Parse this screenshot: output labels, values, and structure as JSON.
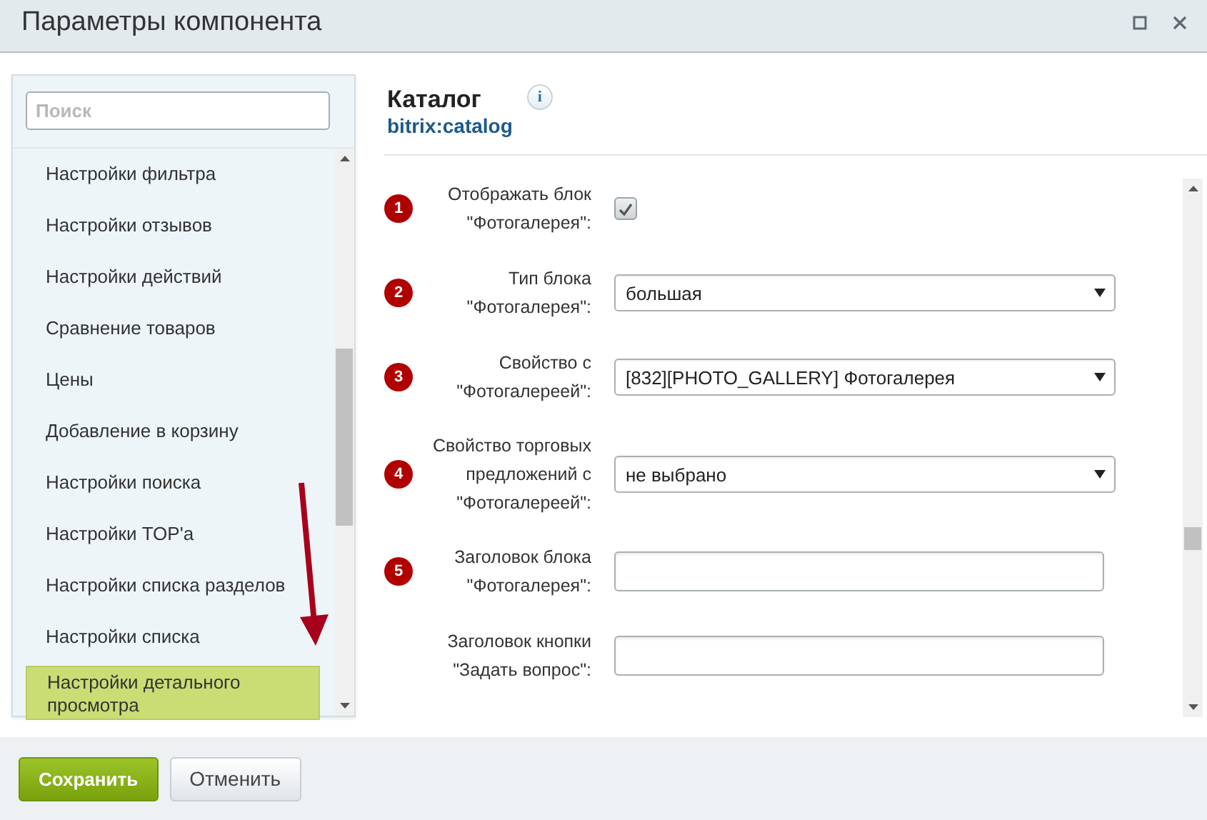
{
  "window": {
    "title": "Параметры компонента"
  },
  "sidebar": {
    "search": {
      "placeholder": "Поиск"
    },
    "items": [
      {
        "label": "Настройки фильтра",
        "selected": false
      },
      {
        "label": "Настройки отзывов",
        "selected": false
      },
      {
        "label": "Настройки действий",
        "selected": false
      },
      {
        "label": "Сравнение товаров",
        "selected": false
      },
      {
        "label": "Цены",
        "selected": false
      },
      {
        "label": "Добавление в корзину",
        "selected": false
      },
      {
        "label": "Настройки поиска",
        "selected": false
      },
      {
        "label": "Настройки TOP'a",
        "selected": false
      },
      {
        "label": "Настройки списка разделов",
        "selected": false
      },
      {
        "label": "Настройки списка",
        "selected": false
      },
      {
        "label": "Настройки детального просмотра",
        "selected": true
      }
    ]
  },
  "component": {
    "title": "Каталог",
    "code": "bitrix:catalog",
    "info": "i"
  },
  "fields": [
    {
      "badge": "1",
      "label": "Отображать блок \"Фотогалерея\":",
      "kind": "checkbox",
      "checked": true
    },
    {
      "badge": "2",
      "label": "Тип блока \"Фотогалерея\":",
      "kind": "select",
      "value": "большая"
    },
    {
      "badge": "3",
      "label": "Свойство с \"Фотогалереей\":",
      "kind": "select",
      "value": "[832][PHOTO_GALLERY] Фотогалерея"
    },
    {
      "badge": "4",
      "label": "Свойство торговых предложений с \"Фотогалереей\":",
      "kind": "select",
      "value": "не выбрано"
    },
    {
      "badge": "5",
      "label": "Заголовок блока \"Фотогалерея\":",
      "kind": "text"
    },
    {
      "label": "Заголовок кнопки \"Задать вопрос\":",
      "kind": "text"
    }
  ],
  "buttons": [
    {
      "label": "Сохранить",
      "kind": "primary"
    },
    {
      "label": "Отменить",
      "kind": "secondary"
    }
  ]
}
